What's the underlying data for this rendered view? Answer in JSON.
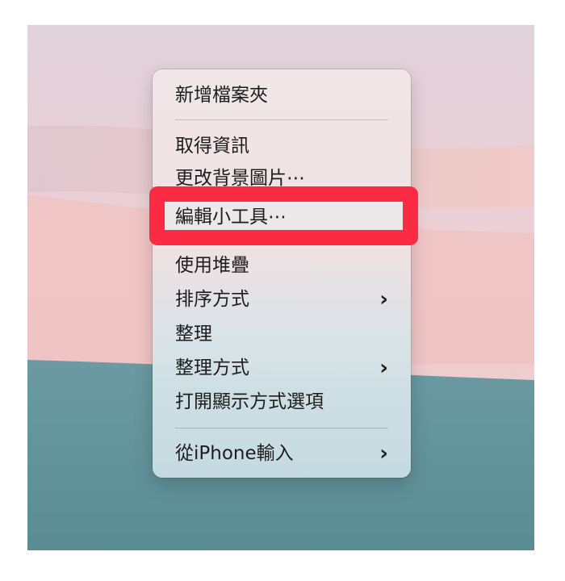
{
  "wallpaper": {
    "colors": {
      "lilac": "#e3d4dc",
      "pink": "#f0c6c6",
      "peach": "#f3cfc9",
      "teal": "#5f9199"
    }
  },
  "context_menu": {
    "items": [
      {
        "label": "新增檔案夾"
      },
      {
        "label": "取得資訊"
      },
      {
        "label": "更改背景圖片⋯"
      },
      {
        "label": "編輯小工具⋯"
      },
      {
        "label": "使用堆疊"
      },
      {
        "label": "排序方式",
        "submenu_icon": "›"
      },
      {
        "label": "整理"
      },
      {
        "label": "整理方式",
        "submenu_icon": "›"
      },
      {
        "label": "打開顯示方式選項"
      },
      {
        "label": "從iPhone輸入",
        "submenu_icon": "›"
      }
    ]
  },
  "annotation": {
    "highlight_color": "#fb2b43",
    "highlighted_item": "編輯小工具⋯"
  }
}
